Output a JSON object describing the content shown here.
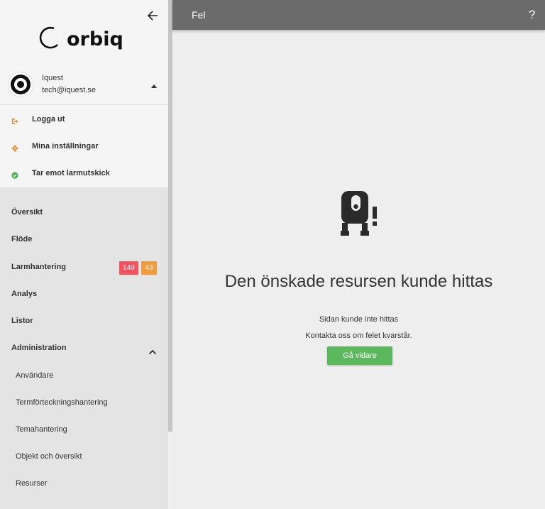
{
  "header": {
    "title": "Fel",
    "help_icon": "?"
  },
  "sidebar": {
    "logo_text": "orbiq",
    "back_icon": "arrow-left-icon",
    "user": {
      "name": "Iquest",
      "email": "tech@iquest.se"
    },
    "user_menu": [
      {
        "label": "Logga ut",
        "icon": "logout-icon",
        "color": "#f0862f"
      },
      {
        "label": "Mina inställningar",
        "icon": "gear-icon",
        "color": "#f0862f"
      },
      {
        "label": "Tar emot larmutskick",
        "icon": "check-circle-icon",
        "color": "#4caf50"
      }
    ],
    "nav": [
      {
        "label": "Översikt"
      },
      {
        "label": "Flöde"
      },
      {
        "label": "Larmhantering"
      },
      {
        "label": "Analys"
      },
      {
        "label": "Listor"
      },
      {
        "label": "Administration"
      }
    ],
    "badges": {
      "red": "149",
      "orange": "43"
    },
    "sub_items": [
      {
        "label": "Användare"
      },
      {
        "label": "Termförteckningshantering"
      },
      {
        "label": "Temahantering"
      },
      {
        "label": "Objekt och översikt"
      },
      {
        "label": "Resurser"
      }
    ]
  },
  "main": {
    "title": "Den önskade resursen kunde hittas",
    "line1": "Sidan kunde inte hittas",
    "line2": "Kontakta oss om felet kvarstår.",
    "button_label": "Gå vidare"
  },
  "colors": {
    "header_bg": "#6b6b6b",
    "accent_green": "#5cb85c",
    "badge_red": "#f0535f",
    "badge_orange": "#f39a3a"
  }
}
